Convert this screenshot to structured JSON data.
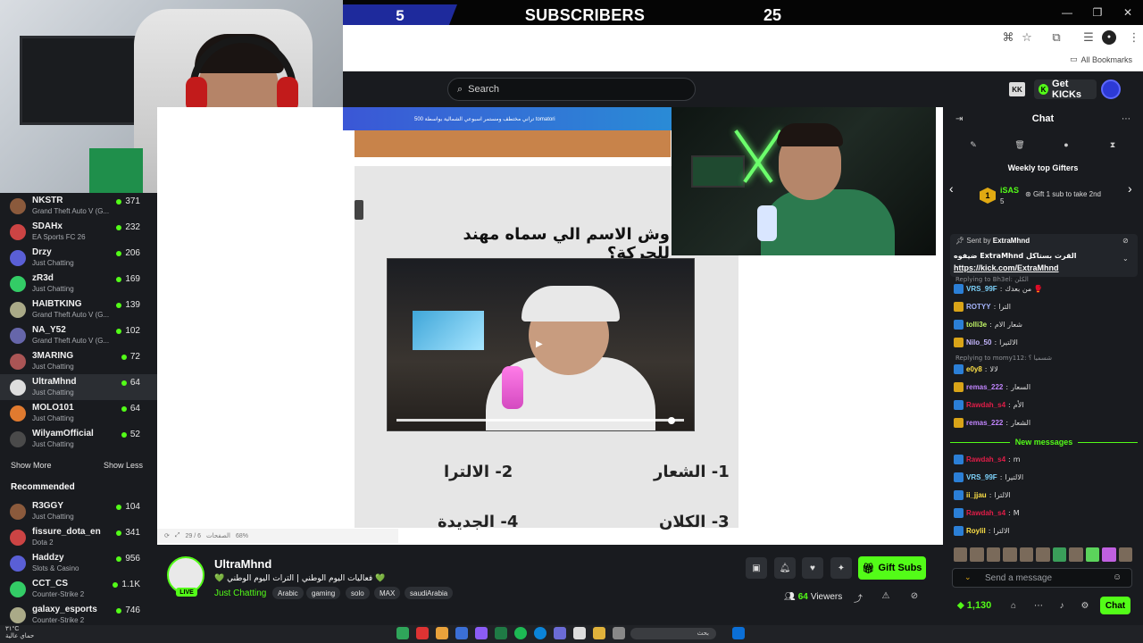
{
  "overlay": {
    "left_score": "5",
    "title": "SUBSCRIBERS",
    "right_score": "25"
  },
  "browser": {
    "all_bookmarks": "All Bookmarks"
  },
  "header": {
    "search_placeholder": "Search",
    "get_kicks": "Get KICKs"
  },
  "sidebar": {
    "channels": [
      {
        "name": "NKSTR",
        "category": "Grand Theft Auto V (G...",
        "viewers": "371"
      },
      {
        "name": "SDAHx",
        "category": "EA Sports FC 26",
        "viewers": "232"
      },
      {
        "name": "Drzy",
        "category": "Just Chatting",
        "viewers": "206"
      },
      {
        "name": "zR3d",
        "category": "Just Chatting",
        "viewers": "169"
      },
      {
        "name": "HAIBTKING",
        "category": "Grand Theft Auto V (G...",
        "viewers": "139"
      },
      {
        "name": "NA_Y52",
        "category": "Grand Theft Auto V (G...",
        "viewers": "102"
      },
      {
        "name": "3MARING",
        "category": "Just Chatting",
        "viewers": "72"
      },
      {
        "name": "UltraMhnd",
        "category": "Just Chatting",
        "viewers": "64"
      },
      {
        "name": "MOLO101",
        "category": "Just Chatting",
        "viewers": "64"
      },
      {
        "name": "WilyamOfficial",
        "category": "Just Chatting",
        "viewers": "52"
      }
    ],
    "show_more": "Show More",
    "show_less": "Show Less",
    "recommended_title": "Recommended",
    "recommended": [
      {
        "name": "R3GGY",
        "category": "Just Chatting",
        "viewers": "104"
      },
      {
        "name": "fissure_dota_en",
        "category": "Dota 2",
        "viewers": "341"
      },
      {
        "name": "Haddzy",
        "category": "Slots & Casino",
        "viewers": "956"
      },
      {
        "name": "CCT_CS",
        "category": "Counter-Strike 2",
        "viewers": "1.1K"
      },
      {
        "name": "galaxy_esports",
        "category": "Counter-Strike 2",
        "viewers": "746"
      }
    ]
  },
  "slide": {
    "banner": "تراني مختطف ومستمر اسبوعي الشمالية بواسطة 500 tomatori",
    "question": "وش الاسم الي سماه مهند للحركة؟",
    "answers": [
      "1- الشعار",
      "2- الالترا",
      "3- الكلان",
      "4- الجديدة"
    ],
    "footer_page": "29 / 6",
    "footer_label": "الصفحات",
    "footer_zoom": "68%"
  },
  "stream": {
    "streamer": "UltraMhnd",
    "live": "LIVE",
    "title": "💚 فعاليات اليوم الوطني | الترات اليوم الوطني 💚",
    "category": "Just Chatting",
    "tags": [
      "Arabic",
      "gaming",
      "solo",
      "MAX",
      "saudiArabia"
    ],
    "gift_subs": "Gift Subs",
    "viewers_count": "64",
    "viewers_label": "Viewers"
  },
  "chat": {
    "title": "Chat",
    "gifters_title": "Weekly top Gifters",
    "gifter_rank": "1",
    "gifter_name": "iSAS",
    "gifter_count": "5",
    "gifter_cta": "Gift 1 sub to take 2nd",
    "pinned_by_label": "Sent by",
    "pinned_by_user": "ExtraMhnd",
    "pinned_text": "ضيفوه ExtraMhnd القرت بستاكل",
    "pinned_link": "https://kick.com/ExtraMhnd",
    "messages": [
      {
        "user": "VRS_99F",
        "text": "من بعدك 🥊",
        "color": "#7dd3fc"
      },
      {
        "user": "ROTYY",
        "text": "الترا",
        "color": "#a5b4fc"
      },
      {
        "user": "tolli3e",
        "text": "شعار الام",
        "color": "#bef264"
      },
      {
        "user": "Nilo_50",
        "text": "الالتيرا",
        "color": "#c4b5fd"
      },
      {
        "user": "e0y8",
        "text": "لالا",
        "color": "#fde047"
      },
      {
        "user": "remas_222",
        "text": "السعار",
        "color": "#c084fc"
      },
      {
        "user": "Rawdah_s4",
        "text": "الأم",
        "color": "#e11d48"
      },
      {
        "user": "remas_222",
        "text": "الشعار",
        "color": "#c084fc"
      }
    ],
    "reply_hints": [
      "Replying to Bh3el: الكلن",
      "Replying to momy112: شسميا ؟"
    ],
    "new_messages": "New messages",
    "new": [
      {
        "user": "Rawdah_s4",
        "text": "m",
        "color": "#e11d48"
      },
      {
        "user": "VRS_99F",
        "text": "الالتيرا",
        "color": "#7dd3fc"
      },
      {
        "user": "ii_jjau",
        "text": "الالترا",
        "color": "#fde047"
      },
      {
        "user": "Rawdah_s4",
        "text": "M",
        "color": "#e11d48"
      },
      {
        "user": "Roylil",
        "text": "الالترا",
        "color": "#fde047"
      }
    ],
    "input_placeholder": "Send a message",
    "kicks_count": "1,130",
    "send_label": "Chat"
  },
  "taskbar": {
    "search_text": "بحث",
    "time": "٣١°C",
    "date": "حماي عالية"
  }
}
